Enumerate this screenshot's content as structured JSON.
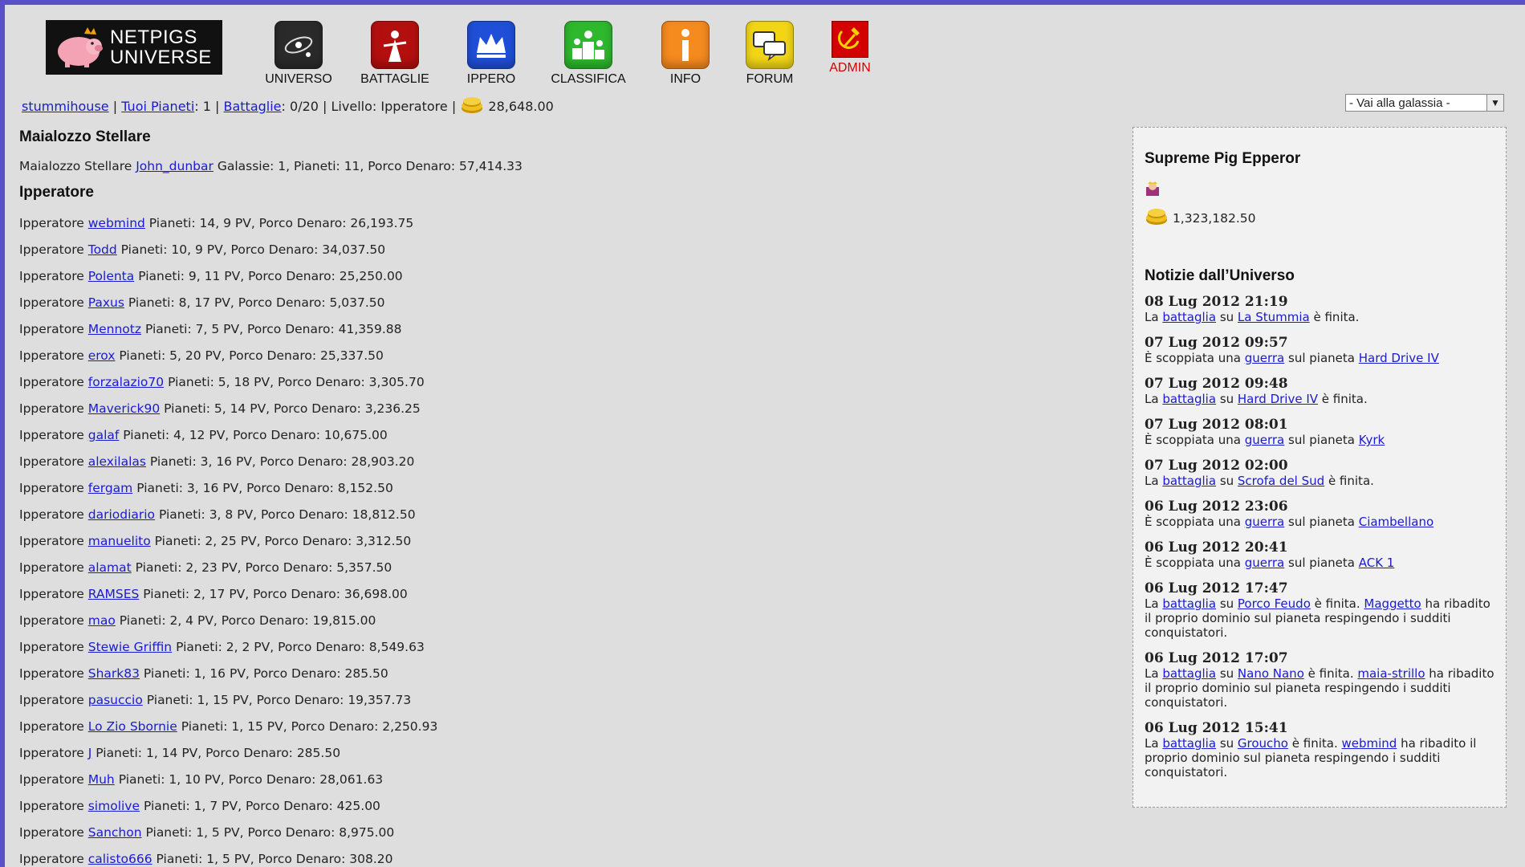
{
  "brand": {
    "line1": "NETPIGS",
    "line2": "UNIVERSE"
  },
  "nav": [
    {
      "label": "UNIVERSO",
      "icon": "galaxy-icon",
      "color": "#2a2a2a"
    },
    {
      "label": "BATTAGLIE",
      "icon": "battle-icon",
      "color": "#b40f0f"
    },
    {
      "label": "IPPERO",
      "icon": "crown-icon",
      "color": "#1f4fd8"
    },
    {
      "label": "CLASSIFICA",
      "icon": "podium-icon",
      "color": "#2eb82e"
    },
    {
      "label": "INFO",
      "icon": "info-icon",
      "color": "#f58a1f"
    },
    {
      "label": "FORUM",
      "icon": "chat-icon",
      "color": "#f2d616"
    },
    {
      "label": "ADMIN",
      "icon": "hammer-sickle-icon",
      "color": "#d40000"
    }
  ],
  "status": {
    "user": "stummihouse",
    "sep1": "|",
    "planets_link": "Tuoi Pianeti",
    "planets_count": ": 1",
    "sep2": "|",
    "battles_link": "Battaglie",
    "battles_count": ": 0/20",
    "sep3": "|",
    "level": "Livello: Ipperatore",
    "sep4": "|",
    "money": "28,648.00"
  },
  "galaxy_select": {
    "value": "- Vai alla galassia -"
  },
  "maialozzo": {
    "heading": "Maialozzo Stellare",
    "prefix": "Maialozzo Stellare",
    "name": "John_dunbar",
    "stats": "Galassie: 1, Pianeti: 11, Porco Denaro: 57,414.33"
  },
  "ipperatori": {
    "heading": "Ipperatore",
    "prefix": "Ipperatore",
    "rows": [
      {
        "name": "webmind",
        "stats": "Pianeti: 14, 9 PV, Porco Denaro: 26,193.75"
      },
      {
        "name": "Todd",
        "stats": "Pianeti: 10, 9 PV, Porco Denaro: 34,037.50"
      },
      {
        "name": "Polenta",
        "stats": "Pianeti: 9, 11 PV, Porco Denaro: 25,250.00"
      },
      {
        "name": "Paxus",
        "stats": "Pianeti: 8, 17 PV, Porco Denaro: 5,037.50"
      },
      {
        "name": "Mennotz",
        "stats": "Pianeti: 7, 5 PV, Porco Denaro: 41,359.88"
      },
      {
        "name": "erox",
        "stats": "Pianeti: 5, 20 PV, Porco Denaro: 25,337.50"
      },
      {
        "name": "forzalazio70",
        "stats": "Pianeti: 5, 18 PV, Porco Denaro: 3,305.70"
      },
      {
        "name": "Maverick90",
        "stats": "Pianeti: 5, 14 PV, Porco Denaro: 3,236.25"
      },
      {
        "name": "galaf",
        "stats": "Pianeti: 4, 12 PV, Porco Denaro: 10,675.00"
      },
      {
        "name": "alexilalas",
        "stats": "Pianeti: 3, 16 PV, Porco Denaro: 28,903.20"
      },
      {
        "name": "fergam",
        "stats": "Pianeti: 3, 16 PV, Porco Denaro: 8,152.50"
      },
      {
        "name": "dariodiario",
        "stats": "Pianeti: 3, 8 PV, Porco Denaro: 18,812.50"
      },
      {
        "name": "manuelito",
        "stats": "Pianeti: 2, 25 PV, Porco Denaro: 3,312.50"
      },
      {
        "name": "alamat",
        "stats": "Pianeti: 2, 23 PV, Porco Denaro: 5,357.50"
      },
      {
        "name": "RAMSES",
        "stats": "Pianeti: 2, 17 PV, Porco Denaro: 36,698.00"
      },
      {
        "name": "mao",
        "stats": "Pianeti: 2, 4 PV, Porco Denaro: 19,815.00"
      },
      {
        "name": "Stewie Griffin",
        "stats": "Pianeti: 2, 2 PV, Porco Denaro: 8,549.63"
      },
      {
        "name": "Shark83",
        "stats": "Pianeti: 1, 16 PV, Porco Denaro: 285.50"
      },
      {
        "name": "pasuccio",
        "stats": "Pianeti: 1, 15 PV, Porco Denaro: 19,357.73"
      },
      {
        "name": "Lo Zio Sbornie",
        "stats": "Pianeti: 1, 15 PV, Porco Denaro: 2,250.93"
      },
      {
        "name": "J",
        "stats": "Pianeti: 1, 14 PV, Porco Denaro: 285.50"
      },
      {
        "name": "Muh",
        "stats": "Pianeti: 1, 10 PV, Porco Denaro: 28,061.63"
      },
      {
        "name": "simolive",
        "stats": "Pianeti: 1, 7 PV, Porco Denaro: 425.00"
      },
      {
        "name": "Sanchon",
        "stats": "Pianeti: 1, 5 PV, Porco Denaro: 8,975.00"
      },
      {
        "name": "calisto666",
        "stats": "Pianeti: 1, 5 PV, Porco Denaro: 308.20"
      }
    ]
  },
  "sidebar": {
    "emperor_heading": "Supreme Pig Epperor",
    "emperor_money": "1,323,182.50",
    "news_heading": "Notizie dall’Universo",
    "news": [
      {
        "date": "08 Lug 2012 21:19",
        "parts": [
          [
            "t",
            "La "
          ],
          [
            "a",
            "battaglia"
          ],
          [
            "t",
            " su "
          ],
          [
            "a",
            "La Stummia"
          ],
          [
            "t",
            " è finita."
          ]
        ]
      },
      {
        "date": "07 Lug 2012 09:57",
        "parts": [
          [
            "t",
            "È scoppiata una "
          ],
          [
            "a",
            "guerra"
          ],
          [
            "t",
            " sul pianeta "
          ],
          [
            "a",
            "Hard Drive IV"
          ]
        ]
      },
      {
        "date": "07 Lug 2012 09:48",
        "parts": [
          [
            "t",
            "La "
          ],
          [
            "a",
            "battaglia"
          ],
          [
            "t",
            " su "
          ],
          [
            "a",
            "Hard Drive IV"
          ],
          [
            "t",
            " è finita."
          ]
        ]
      },
      {
        "date": "07 Lug 2012 08:01",
        "parts": [
          [
            "t",
            "È scoppiata una "
          ],
          [
            "a",
            "guerra"
          ],
          [
            "t",
            " sul pianeta "
          ],
          [
            "a",
            "Kyrk"
          ]
        ]
      },
      {
        "date": "07 Lug 2012 02:00",
        "parts": [
          [
            "t",
            "La "
          ],
          [
            "a",
            "battaglia"
          ],
          [
            "t",
            " su "
          ],
          [
            "a",
            "Scrofa del Sud"
          ],
          [
            "t",
            " è finita."
          ]
        ]
      },
      {
        "date": "06 Lug 2012 23:06",
        "parts": [
          [
            "t",
            "È scoppiata una "
          ],
          [
            "a",
            "guerra"
          ],
          [
            "t",
            " sul pianeta "
          ],
          [
            "a",
            "Ciambellano"
          ]
        ]
      },
      {
        "date": "06 Lug 2012 20:41",
        "parts": [
          [
            "t",
            "È scoppiata una "
          ],
          [
            "a",
            "guerra"
          ],
          [
            "t",
            " sul pianeta "
          ],
          [
            "a",
            "ACK 1"
          ]
        ]
      },
      {
        "date": "06 Lug 2012 17:47",
        "parts": [
          [
            "t",
            "La "
          ],
          [
            "a",
            "battaglia"
          ],
          [
            "t",
            " su "
          ],
          [
            "a",
            "Porco Feudo"
          ],
          [
            "t",
            " è finita. "
          ],
          [
            "a",
            "Maggetto"
          ],
          [
            "t",
            " ha ribadito il proprio dominio sul pianeta respingendo i sudditi conquistatori."
          ]
        ]
      },
      {
        "date": "06 Lug 2012 17:07",
        "parts": [
          [
            "t",
            "La "
          ],
          [
            "a",
            "battaglia"
          ],
          [
            "t",
            " su "
          ],
          [
            "a",
            "Nano Nano"
          ],
          [
            "t",
            " è finita. "
          ],
          [
            "a",
            "maia-strillo"
          ],
          [
            "t",
            " ha ribadito il proprio dominio sul pianeta respingendo i sudditi conquistatori."
          ]
        ]
      },
      {
        "date": "06 Lug 2012 15:41",
        "parts": [
          [
            "t",
            "La "
          ],
          [
            "a",
            "battaglia"
          ],
          [
            "t",
            " su "
          ],
          [
            "a",
            "Groucho"
          ],
          [
            "t",
            " è finita. "
          ],
          [
            "a",
            "webmind"
          ],
          [
            "t",
            " ha ribadito il proprio dominio sul pianeta respingendo i sudditi conquistatori."
          ]
        ]
      }
    ]
  }
}
